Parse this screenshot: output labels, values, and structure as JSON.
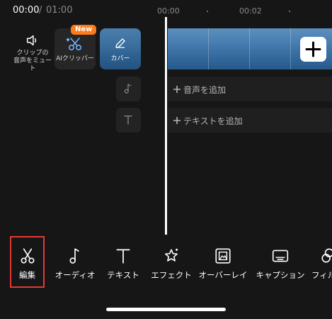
{
  "header": {
    "current_time": "00:00",
    "separator": "/",
    "total_time": "01:00",
    "ruler": [
      "00:00",
      "00:02"
    ]
  },
  "left_tools": {
    "mute_label_line1": "クリップの",
    "mute_label_line2": "音声をミュート",
    "ai_clipper_label": "AIクリッパー",
    "new_badge": "New",
    "cover_label": "カバー"
  },
  "tracks": {
    "audio_label": "音声を追加",
    "text_label": "テキストを追加"
  },
  "toolbar": {
    "items": [
      {
        "label": "編集",
        "icon": "scissors-icon"
      },
      {
        "label": "オーディオ",
        "icon": "music-note-icon"
      },
      {
        "label": "テキスト",
        "icon": "text-icon"
      },
      {
        "label": "エフェクト",
        "icon": "star-sparkle-icon"
      },
      {
        "label": "オーバーレイ",
        "icon": "overlay-icon"
      },
      {
        "label": "キャプション",
        "icon": "caption-icon"
      },
      {
        "label": "フィル",
        "icon": "filter-icon"
      }
    ],
    "selected_index": 0
  },
  "colors": {
    "background": "#161616",
    "selection_border": "#e23a32",
    "new_badge": "#ff7a1a"
  }
}
